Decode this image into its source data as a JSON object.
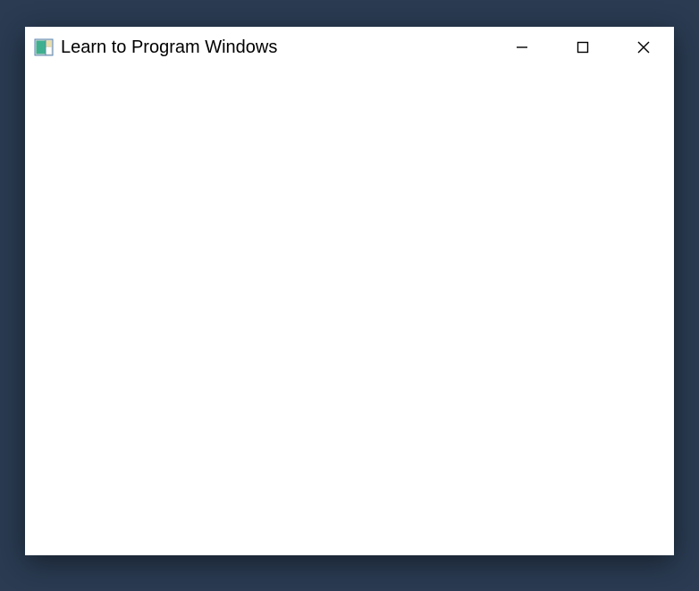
{
  "window": {
    "title": "Learn to Program Windows",
    "icons": {
      "app": "app-icon",
      "minimize": "minimize-icon",
      "maximize": "maximize-icon",
      "close": "close-icon"
    }
  }
}
